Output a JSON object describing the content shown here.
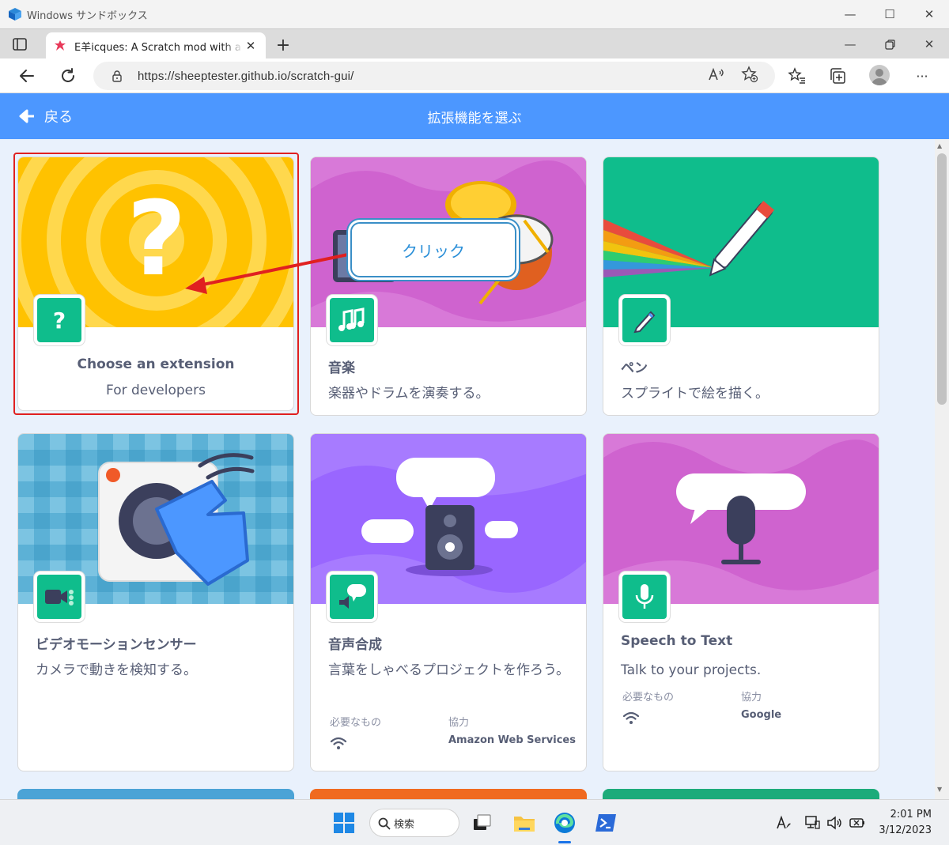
{
  "sandbox": {
    "title": "Windows サンドボックス"
  },
  "window_controls": {
    "minimize": "—",
    "maximize": "☐",
    "close": "✕"
  },
  "browser": {
    "tab_title": "E羊icques: A Scratch mod with a",
    "tab_close": "✕",
    "new_tab": "+",
    "url": "https://sheeptester.github.io/scratch-gui/",
    "more_label": "···"
  },
  "scratch": {
    "back_label": "戻る",
    "header_title": "拡張機能を選ぶ",
    "callout_text": "クリック",
    "requires_label": "必要なもの",
    "collab_label": "協力",
    "cards": [
      {
        "name": "Choose an extension",
        "desc": "For developers",
        "icon": "question-icon"
      },
      {
        "name": "音楽",
        "desc": "楽器やドラムを演奏する。",
        "icon": "music-note-icon"
      },
      {
        "name": "ペン",
        "desc": "スプライトで絵を描く。",
        "icon": "pen-icon"
      },
      {
        "name": "ビデオモーションセンサー",
        "desc": "カメラで動きを検知する。",
        "icon": "video-sensing-icon"
      },
      {
        "name": "音声合成",
        "desc": "言葉をしゃべるプロジェクトを作ろう。",
        "icon": "speech-bubble-icon",
        "collaborator": "Amazon Web Services"
      },
      {
        "name": "Speech to Text",
        "desc": "Talk to your projects.",
        "icon": "microphone-icon",
        "collaborator": "Google"
      }
    ]
  },
  "taskbar": {
    "search_label": "検索",
    "time": "2:01 PM",
    "date": "3/12/2023"
  },
  "colors": {
    "scratch_blue": "#4c97ff",
    "extension_green": "#0fbd8c",
    "highlight_red": "#e02020"
  }
}
